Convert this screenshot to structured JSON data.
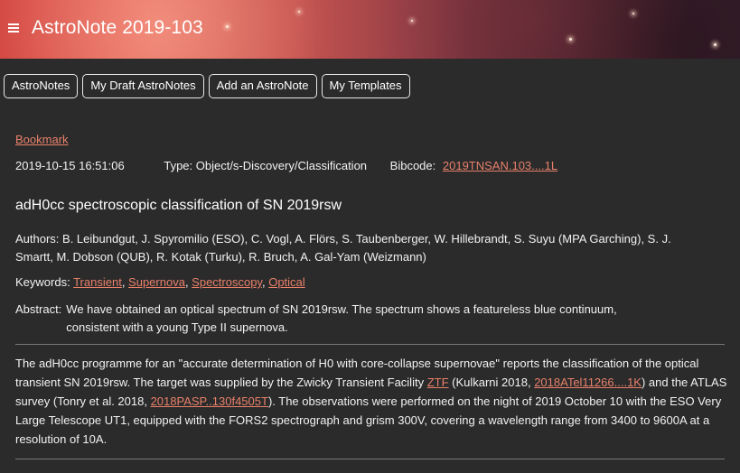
{
  "header": {
    "title": "AstroNote 2019-103",
    "menu_icon": "hamburger-menu-icon"
  },
  "nav": {
    "items": [
      "AstroNotes",
      "My Draft AstroNotes",
      "Add an AstroNote",
      "My Templates"
    ]
  },
  "note": {
    "bookmark_label": "Bookmark",
    "timestamp": "2019-10-15 16:51:06",
    "type_label": "Type: Object/s-Discovery/Classification",
    "bibcode_label": "Bibcode:",
    "bibcode_value": "2019TNSAN.103....1L",
    "title": "adH0cc spectroscopic classification of SN 2019rsw",
    "authors": "Authors: B. Leibundgut, J. Spyromilio (ESO), C. Vogl, A. Flörs, S. Taubenberger, W. Hillebrandt, S. Suyu (MPA Garching), S. J. Smartt, M. Dobson (QUB), R. Kotak (Turku), R. Bruch, A. Gal-Yam (Weizmann)",
    "keywords_label": "Keywords:",
    "keywords": [
      "Transient",
      "Supernova",
      "Spectroscopy",
      "Optical"
    ],
    "abstract_label": "Abstract:",
    "abstract": "We have obtained an optical spectrum of SN 2019rsw. The spectrum shows a featureless blue continuum, consistent with a young Type II supernova.",
    "body": {
      "p1": "The adH0cc programme for an \"accurate determination of H0 with core-collapse supernovae\" reports the classification of the optical transient SN 2019rsw. The target was supplied by the Zwicky Transient Facility ",
      "link_ztf": "ZTF",
      "p2": " (Kulkarni 2018, ",
      "link_atel": "2018ATel11266....1K",
      "p3": ") and the ATLAS survey (Tonry et al. 2018, ",
      "link_pasp": "2018PASP..130f4505T",
      "p4": "). The observations were performed  on the night of 2019 October 10 with the ESO Very Large Telescope UT1, equipped with the FORS2 spectrograph and grism 300V, covering a wavelength range from 3400 to 9600A at a resolution of 10A."
    }
  },
  "colors": {
    "link": "#e8806a",
    "background": "#2b2b2b",
    "text": "#f2f2f2"
  }
}
